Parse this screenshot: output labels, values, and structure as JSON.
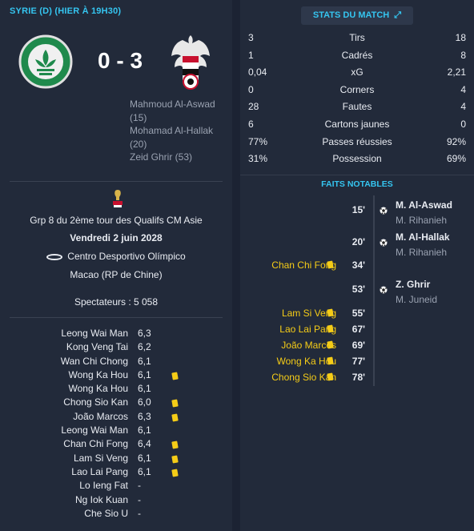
{
  "header": {
    "title": "SYRIE (D) (HIER À 19H30)"
  },
  "match": {
    "score": "0 - 3",
    "home_team_crest": "macau-crest",
    "away_team_crest": "syria-eagle-crest",
    "away_scorers": [
      "Mahmoud Al-Aswad",
      "(15)",
      "Mohamad Al-Hallak",
      "(20)",
      "Zeid Ghrir (53)"
    ]
  },
  "info": {
    "competition": "Grp 8 du 2ème tour des Qualifs CM Asie",
    "date": "Vendredi 2 juin 2028",
    "venue": "Centro Desportivo Olímpico",
    "city": "Macao (RP de Chine)",
    "attendance": "Spectateurs : 5 058"
  },
  "ratings": [
    {
      "name": "Leong Wai Man",
      "rating": "6,3",
      "card": false
    },
    {
      "name": "Kong Veng Tai",
      "rating": "6,2",
      "card": false
    },
    {
      "name": "Wan Chi Chong",
      "rating": "6,1",
      "card": false
    },
    {
      "name": "Wong Ka Hou",
      "rating": "6,1",
      "card": true
    },
    {
      "name": "Wong Ka Hou",
      "rating": "6,1",
      "card": false
    },
    {
      "name": "Chong Sio Kan",
      "rating": "6,0",
      "card": true
    },
    {
      "name": "João Marcos",
      "rating": "6,3",
      "card": true
    },
    {
      "name": "Leong Wai Man",
      "rating": "6,1",
      "card": false
    },
    {
      "name": "Chan Chi Fong",
      "rating": "6,4",
      "card": true
    },
    {
      "name": "Lam Si Veng",
      "rating": "6,1",
      "card": true
    },
    {
      "name": "Lao Lai Pang",
      "rating": "6,1",
      "card": true
    },
    {
      "name": "Lo Ieng Fat",
      "rating": "-",
      "card": false
    },
    {
      "name": "Ng Iok Kuan",
      "rating": "-",
      "card": false
    },
    {
      "name": "Che Sio U",
      "rating": "-",
      "card": false
    }
  ],
  "stats_button": {
    "label": "STATS DU MATCH"
  },
  "stats": [
    {
      "home": "3",
      "label": "Tirs",
      "away": "18"
    },
    {
      "home": "1",
      "label": "Cadrés",
      "away": "8"
    },
    {
      "home": "0,04",
      "label": "xG",
      "away": "2,21"
    },
    {
      "home": "0",
      "label": "Corners",
      "away": "4"
    },
    {
      "home": "28",
      "label": "Fautes",
      "away": "4"
    },
    {
      "home": "6",
      "label": "Cartons jaunes",
      "away": "0"
    },
    {
      "home": "77%",
      "label": "Passes réussies",
      "away": "92%"
    },
    {
      "home": "31%",
      "label": "Possession",
      "away": "69%"
    }
  ],
  "highlights": {
    "title": "FAITS NOTABLES",
    "events": [
      {
        "minute": "15'",
        "type": "goal",
        "scorer": "M. Al-Aswad",
        "assist": "M. Rihanieh"
      },
      {
        "minute": "20'",
        "type": "goal",
        "scorer": "M. Al-Hallak",
        "assist": "M. Rihanieh"
      },
      {
        "minute": "34'",
        "type": "card",
        "player": "Chan Chi Fong"
      },
      {
        "minute": "53'",
        "type": "goal",
        "scorer": "Z. Ghrir",
        "assist": "M. Juneid"
      },
      {
        "minute": "55'",
        "type": "card",
        "player": "Lam Si Veng"
      },
      {
        "minute": "67'",
        "type": "card",
        "player": "Lao Lai Pang"
      },
      {
        "minute": "69'",
        "type": "card",
        "player": "João Marcos"
      },
      {
        "minute": "77'",
        "type": "card",
        "player": "Wong Ka Hou"
      },
      {
        "minute": "78'",
        "type": "card",
        "player": "Chong Sio Kan"
      }
    ]
  },
  "colors": {
    "accent": "#35c5f0",
    "yellow_card": "#f5cc17",
    "background": "#222a3a"
  }
}
